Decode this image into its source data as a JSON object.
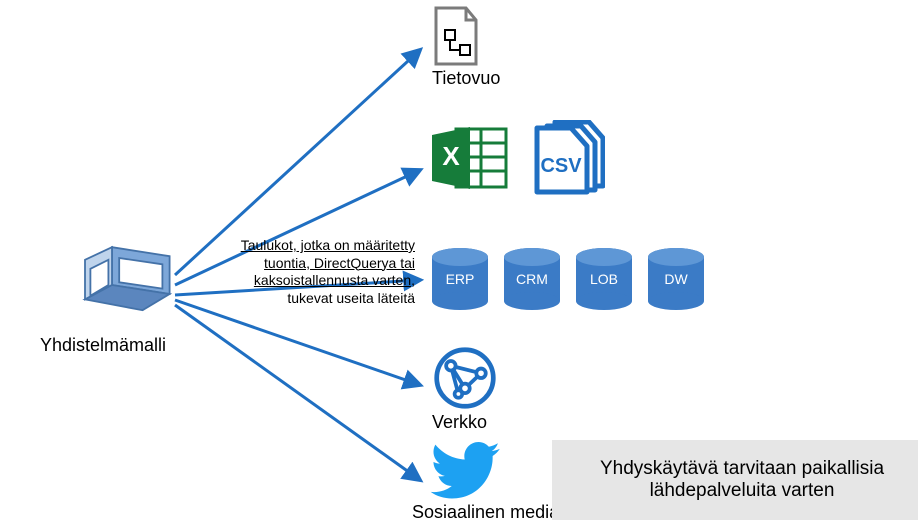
{
  "source": {
    "label": "Yhdistelmämalli"
  },
  "annotation": {
    "line1": "Taulukot, jotka on määritetty",
    "line2": "tuontia, DirectQuerya tai",
    "line3": "kaksoistallennusta varten,",
    "line4": "tukevat useita läteitä"
  },
  "targets": {
    "dataflow": {
      "label": "Tietovuo"
    },
    "files": {
      "csv_label": "CSV"
    },
    "databases": [
      {
        "name": "ERP"
      },
      {
        "name": "CRM"
      },
      {
        "name": "LOB"
      },
      {
        "name": "DW"
      }
    ],
    "web": {
      "label": "Verkko"
    },
    "social": {
      "label": "Sosiaalinen media"
    }
  },
  "info": {
    "line1": "Yhdyskäytävä tarvitaan paikallisia",
    "line2": "lähdepalveluita varten"
  },
  "colors": {
    "arrow": "#1F6FC2",
    "db_fill": "#3B7BC6",
    "excel_green": "#167C3A",
    "csv_blue": "#1F6FC2",
    "twitter": "#1DA1F2"
  }
}
